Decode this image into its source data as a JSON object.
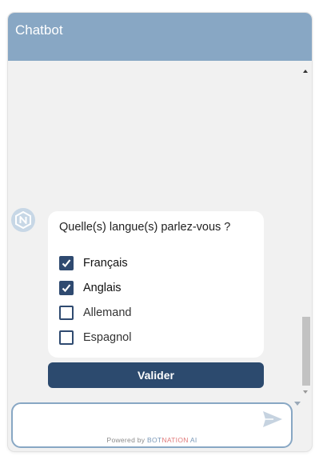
{
  "header": {
    "title": "Chatbot"
  },
  "message": {
    "question": "Quelle(s) langue(s) parlez-vous ?",
    "options": [
      {
        "label": "Français",
        "checked": true
      },
      {
        "label": "Anglais",
        "checked": true
      },
      {
        "label": "Allemand",
        "checked": false
      },
      {
        "label": "Espagnol",
        "checked": false
      }
    ],
    "submit_label": "Valider"
  },
  "composer": {
    "value": "",
    "placeholder": "",
    "powered_prefix": "Powered by",
    "brand_bot": "BOT",
    "brand_nation": "NATION",
    "brand_ai": "AI"
  },
  "colors": {
    "header": "#88a7c4",
    "accent": "#2c4a6e",
    "checkbox": "#2f4a70",
    "panel": "#f1f1f1"
  },
  "icons": {
    "avatar": "botnation-logo-icon",
    "send": "send-icon",
    "check": "check-icon"
  }
}
